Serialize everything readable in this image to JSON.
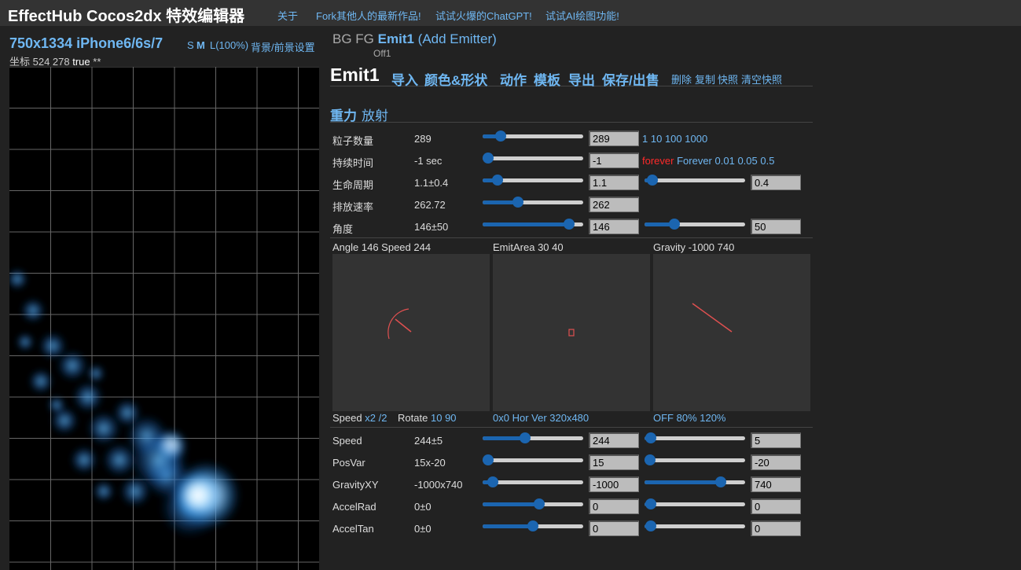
{
  "app": {
    "title": "EffectHub Cocos2dx 特效编辑器",
    "links": [
      "关于",
      "Fork其他人的最新作品!",
      "试试火爆的ChatGPT!",
      "试试AI绘图功能!"
    ]
  },
  "left": {
    "device_title": "750x1334 iPhone6/6s/7",
    "size_s": "S",
    "size_m": "M",
    "size_l": "L(100%)",
    "bg_settings": "背景/前景设置",
    "coords_label": "坐标 524 278",
    "coords_true": "true",
    "coords_stars": "**"
  },
  "layers": {
    "bg": "BG",
    "fg": "FG",
    "current": "Emit1",
    "add": "(Add Emitter)",
    "sub": "Off1"
  },
  "menu": {
    "emitter_name": "Emit1",
    "items": [
      "导入",
      "颜色&形状",
      "动作",
      "模板",
      "导出",
      "保存/出售"
    ],
    "small": [
      "删除",
      "复制",
      "快照"
    ],
    "clear": "清空快照"
  },
  "mode": {
    "gravity": "重力",
    "radial": "放射"
  },
  "rows_top": [
    {
      "label": "粒子数量",
      "value": "289",
      "slider1": 0.18,
      "input1": "289"
    },
    {
      "label": "持续时间",
      "value": "-1 sec",
      "slider1": 0.05,
      "input1": "-1"
    },
    {
      "label": "生命周期",
      "value": "1.1±0.4",
      "slider1": 0.15,
      "input1": "1.1",
      "slider2": 0.08,
      "input2": "0.4"
    },
    {
      "label": "排放速率",
      "value": "262.72",
      "slider1": 0.35,
      "input1": "262"
    },
    {
      "label": "角度",
      "value": "146±50",
      "slider1": 0.86,
      "input1": "146",
      "slider2": 0.3,
      "input2": "50"
    }
  ],
  "quick": {
    "count": [
      "1",
      "10",
      "100",
      "1000"
    ],
    "duration_forever_red": "forever",
    "duration": [
      "Forever",
      "0.01",
      "0.05",
      "0.5"
    ]
  },
  "panels": {
    "angle_label": "Angle 146 Speed 244",
    "area_label": "EmitArea 30 40",
    "gravity_label": "Gravity -1000 740",
    "speed_text": "Speed",
    "speed_x2": "x2",
    "speed_div2": "/2",
    "rotate_text": "Rotate",
    "rotate_10": "10",
    "rotate_90": "90",
    "area_sub": "0x0 Hor Ver 320x480",
    "gravity_sub": "OFF 80% 120%"
  },
  "rows_bottom": [
    {
      "label": "Speed",
      "value": "244±5",
      "slider1": 0.42,
      "input1": "244",
      "slider2": 0.06,
      "input2": "5"
    },
    {
      "label": "PosVar",
      "value": "15x-20",
      "slider1": 0.05,
      "input1": "15",
      "slider2": 0.05,
      "input2": "-20"
    },
    {
      "label": "GravityXY",
      "value": "-1000x740",
      "slider1": 0.1,
      "input1": "-1000",
      "slider2": 0.76,
      "input2": "740"
    },
    {
      "label": "AccelRad",
      "value": "0±0",
      "slider1": 0.56,
      "input1": "0",
      "slider2": 0.06,
      "input2": "0"
    },
    {
      "label": "AccelTan",
      "value": "0±0",
      "slider1": 0.5,
      "input1": "0",
      "slider2": 0.06,
      "input2": "0"
    }
  ]
}
